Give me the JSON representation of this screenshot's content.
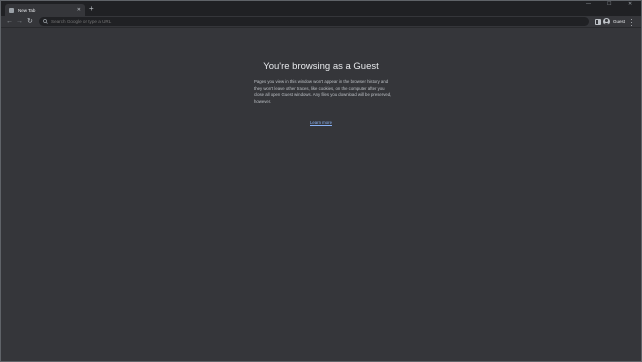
{
  "tab": {
    "title": "New Tab",
    "close_glyph": "✕",
    "favicon_icon": "new-tab-favicon"
  },
  "new_tab_glyph": "+",
  "window_controls": {
    "minimize": "—",
    "maximize": "☐",
    "close": "✕"
  },
  "toolbar": {
    "back_glyph": "←",
    "forward_glyph": "→",
    "reload_glyph": "↻",
    "omnibox_placeholder": "Search Google or type a URL",
    "profile_label": "Guest"
  },
  "content": {
    "title": "You're browsing as a Guest",
    "body": "Pages you view in this window won't appear in the browser history and they won't leave other traces, like cookies, on the computer after you close all open Guest windows. Any files you download will be preserved, however.",
    "learn_more": "Learn more"
  },
  "colors": {
    "background": "#35363a",
    "tabstrip": "#202124",
    "link": "#8ab4f8",
    "text": "#e8eaed"
  }
}
